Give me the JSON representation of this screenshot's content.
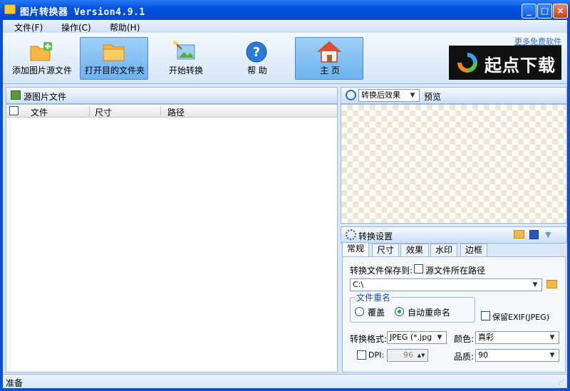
{
  "window": {
    "title": "图片转换器 Version4.9.1"
  },
  "menu": {
    "file": "文件(F)",
    "operate": "操作(C)",
    "help": "帮助(H)"
  },
  "toolbar": {
    "add_source": "添加图片源文件",
    "open_dest": "打开目的文件夹",
    "start": "开始转换",
    "help": "帮 助",
    "home": "主 页",
    "more_link": "更多免费软件",
    "logo_text": "起点下载"
  },
  "left": {
    "header": "源图片文件",
    "columns": [
      "文件",
      "尺寸",
      "路径"
    ]
  },
  "preview": {
    "mode": "转换后效果",
    "label": "预览"
  },
  "settings": {
    "header": "转换设置",
    "tabs": [
      "常规",
      "尺寸",
      "效果",
      "水印",
      "边框"
    ],
    "save_to_label": "转换文件保存到:",
    "source_path_label": "源文件所在路径",
    "save_path": "C:\\",
    "rename_group": "文件重名",
    "overwrite": "覆盖",
    "auto_rename": "自动重命名",
    "keep_exif": "保留EXIF(JPEG)",
    "format_label": "转换格式:",
    "format_value": "JPEG (*.jpg",
    "color_label": "颜色:",
    "color_value": "真彩",
    "dpi_label": "DPI:",
    "dpi_value": "96",
    "quality_label": "品质:",
    "quality_value": "90"
  },
  "status": {
    "text": "准备"
  },
  "colors": {
    "titlebar": "#0a48c8",
    "accent": "#6db2ee"
  }
}
